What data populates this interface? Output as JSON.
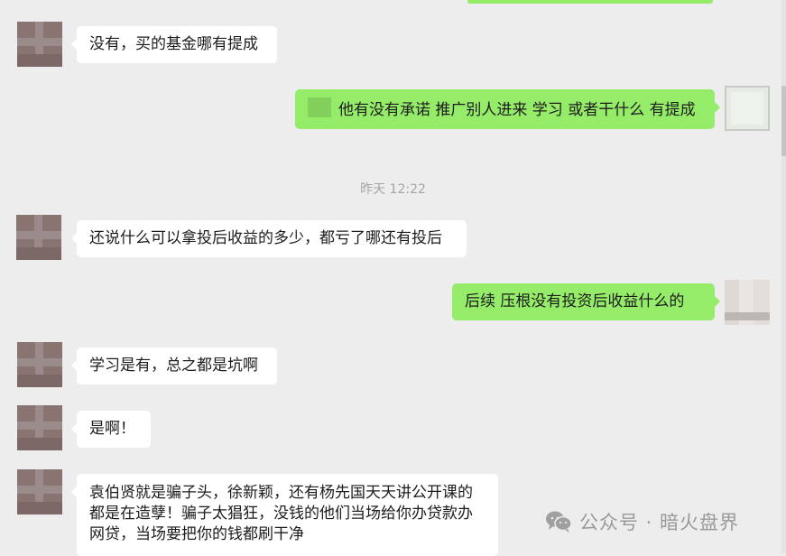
{
  "messages": [
    {
      "side": "left",
      "text": "没有，买的基金哪有提成"
    },
    {
      "side": "right",
      "text": "他有没有承诺  推广别人进来   学习  或者干什么    有提成"
    },
    {
      "side": "left",
      "text": "还说什么可以拿投后收益的多少，都亏了哪还有投后"
    },
    {
      "side": "right",
      "text": "后续   压根没有投资后收益什么的"
    },
    {
      "side": "left",
      "text": "学习是有，总之都是坑啊"
    },
    {
      "side": "left",
      "text": "是啊！"
    },
    {
      "side": "left",
      "text": "袁伯贤就是骗子头，徐新颖，还有杨先国天天讲公开课的都是在造孽！骗子太猖狂，没钱的他们当场给你办贷款办网贷，当场要把你的钱都刷干净"
    }
  ],
  "timestamp": "昨天 12:22",
  "watermark": {
    "text": "公众号 · 暗火盘界",
    "icon": "wechat-icon"
  },
  "colors": {
    "background": "#ededed",
    "incoming_bubble": "#ffffff",
    "outgoing_bubble": "#95ec69"
  }
}
